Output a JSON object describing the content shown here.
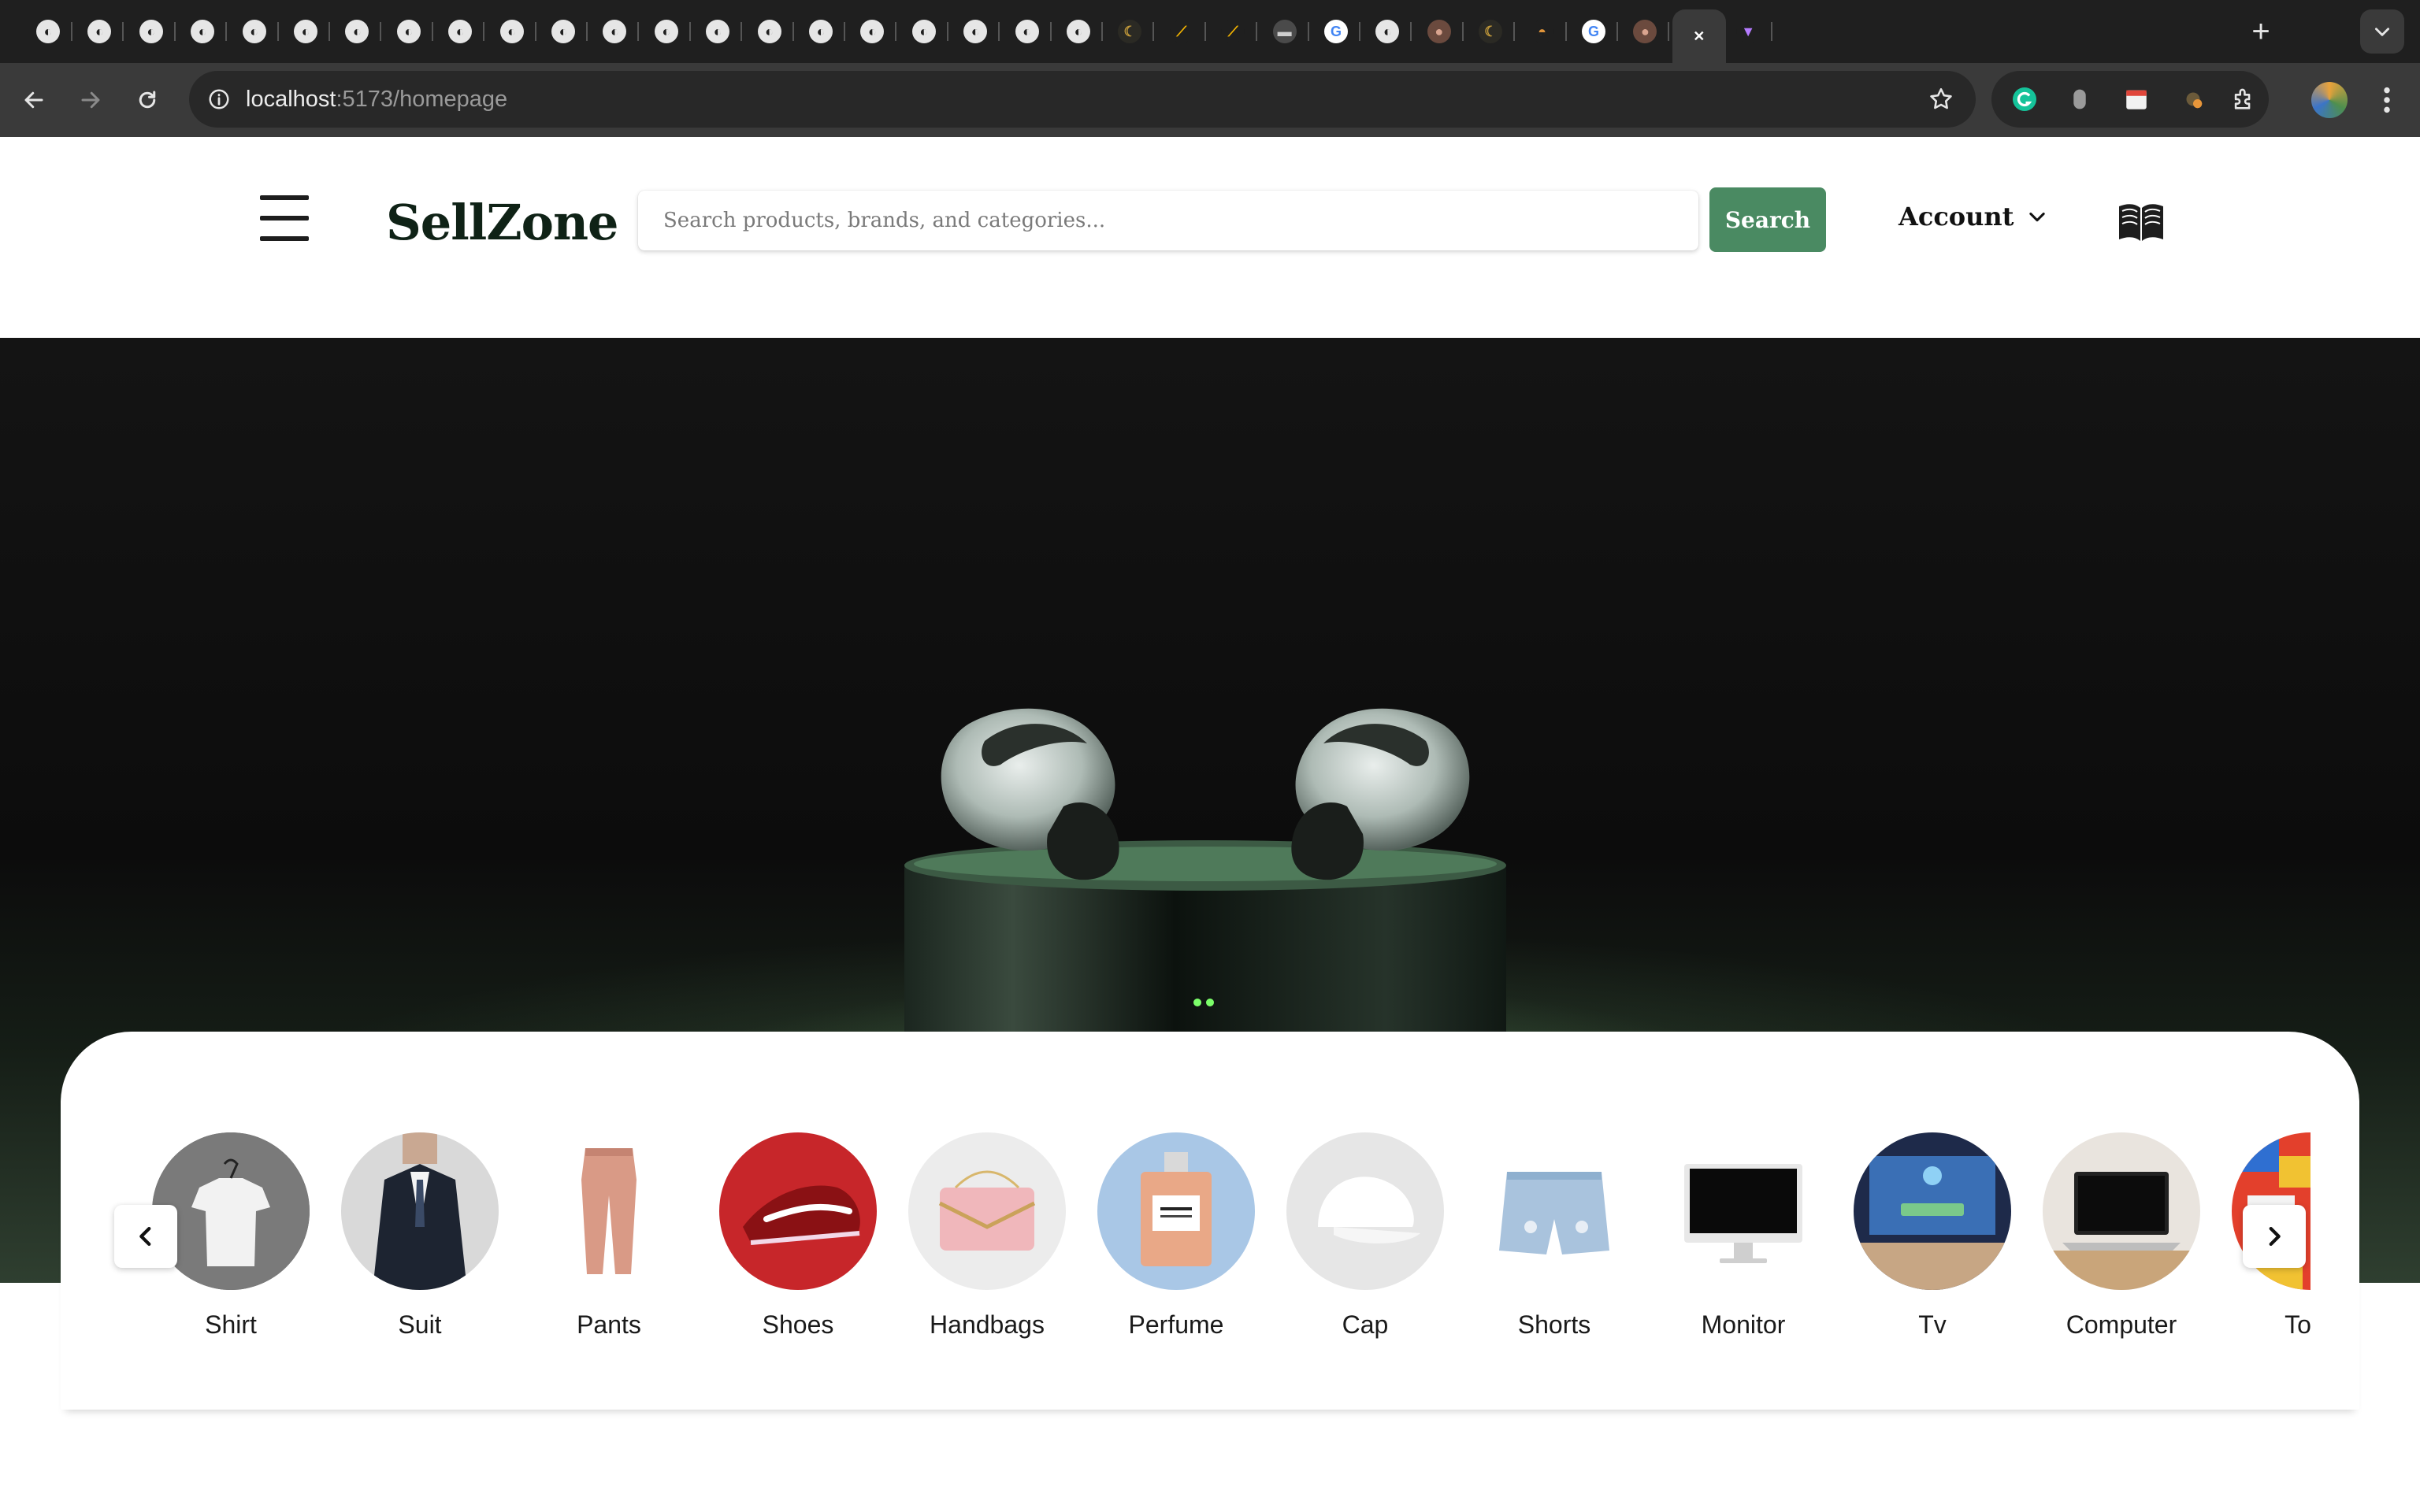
{
  "browser": {
    "url_host": "localhost",
    "url_path": ":5173/homepage",
    "tabs": [
      {
        "icon": "globe-icon"
      },
      {
        "icon": "globe-icon"
      },
      {
        "icon": "globe-icon"
      },
      {
        "icon": "globe-icon"
      },
      {
        "icon": "globe-icon"
      },
      {
        "icon": "globe-icon"
      },
      {
        "icon": "globe-icon"
      },
      {
        "icon": "globe-icon"
      },
      {
        "icon": "globe-icon"
      },
      {
        "icon": "globe-icon"
      },
      {
        "icon": "globe-icon"
      },
      {
        "icon": "globe-icon"
      },
      {
        "icon": "globe-icon"
      },
      {
        "icon": "globe-icon"
      },
      {
        "icon": "globe-icon"
      },
      {
        "icon": "globe-icon"
      },
      {
        "icon": "globe-icon"
      },
      {
        "icon": "globe-icon"
      },
      {
        "icon": "globe-icon"
      },
      {
        "icon": "globe-icon"
      },
      {
        "icon": "globe-icon"
      },
      {
        "icon": "moon-app-icon"
      },
      {
        "icon": "ads-icon"
      },
      {
        "icon": "ads-icon"
      },
      {
        "icon": "app-icon"
      },
      {
        "icon": "google-icon"
      },
      {
        "icon": "globe-icon"
      },
      {
        "icon": "avatar-icon"
      },
      {
        "icon": "moon-app-icon"
      },
      {
        "icon": "burger-icon"
      },
      {
        "icon": "google-icon"
      },
      {
        "icon": "avatar-icon"
      },
      {
        "icon": "close-icon",
        "active": true
      },
      {
        "icon": "vite-icon"
      }
    ],
    "new_tab_label": "+"
  },
  "header": {
    "logo": "SellZone",
    "search_placeholder": "Search products, brands, and categories...",
    "search_button": "Search",
    "account_label": "Account"
  },
  "hero": {
    "image": "airpods-pro-case-on-dark-green-surface"
  },
  "categories": {
    "items": [
      {
        "label": "Shirt",
        "image": "white-tshirt-on-hanger"
      },
      {
        "label": "Suit",
        "image": "man-in-dark-suit"
      },
      {
        "label": "Pants",
        "image": "pink-jogger-pants"
      },
      {
        "label": "Shoes",
        "image": "red-nike-running-shoe"
      },
      {
        "label": "Handbags",
        "image": "pink-chevron-handbag"
      },
      {
        "label": "Perfume",
        "image": "chanel-no5-bottle"
      },
      {
        "label": "Cap",
        "image": "white-trucker-cap"
      },
      {
        "label": "Shorts",
        "image": "distressed-denim-shorts"
      },
      {
        "label": "Monitor",
        "image": "imac-monitor"
      },
      {
        "label": "Tv",
        "image": "smart-tv-wall"
      },
      {
        "label": "Computer",
        "image": "laptop-on-desk"
      },
      {
        "label": "Toys",
        "image": "colorful-toy-bricks"
      }
    ]
  },
  "colors": {
    "brand_green": "#4a8a62",
    "logo_dark": "#0f2216"
  }
}
